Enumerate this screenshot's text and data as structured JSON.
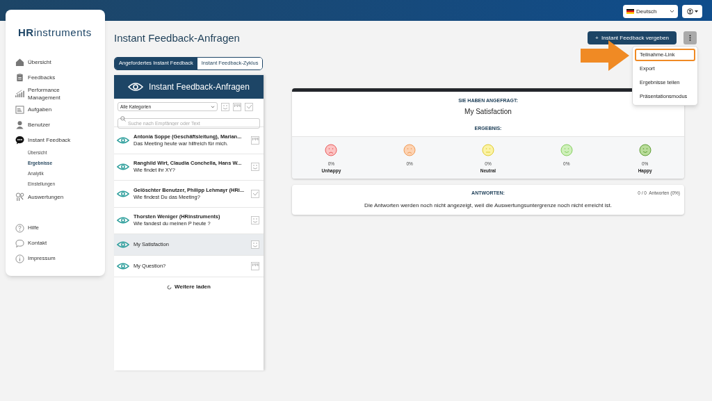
{
  "topbar": {
    "language": "Deutsch"
  },
  "sidebar": {
    "logo": {
      "brand": "HR",
      "rest": "instruments"
    },
    "items": [
      {
        "kind": "main",
        "label": "Übersicht",
        "selected": false
      },
      {
        "kind": "main",
        "label": "Feedbacks",
        "selected": false
      },
      {
        "kind": "main",
        "label": "Performance Management",
        "selected": false
      },
      {
        "kind": "main",
        "label": "Aufgaben",
        "selected": false
      },
      {
        "kind": "main",
        "label": "Benutzer",
        "selected": false
      },
      {
        "kind": "main",
        "label": "Instant Feedback",
        "selected": false
      },
      {
        "kind": "sub",
        "label": "Übersicht",
        "selected": false
      },
      {
        "kind": "sub",
        "label": "Ergebnisse",
        "selected": true
      },
      {
        "kind": "sub",
        "label": "Analytik",
        "selected": false
      },
      {
        "kind": "sub",
        "label": "Einstellungen",
        "selected": false
      },
      {
        "kind": "main",
        "label": "Auswertungen",
        "selected": false
      }
    ],
    "footer_items": [
      {
        "label": "Hilfe"
      },
      {
        "label": "Kontakt"
      },
      {
        "label": "Impressum"
      }
    ]
  },
  "page_title": "Instant Feedback-Anfragen",
  "tabs": [
    {
      "label": "Angefordertes Instant Feedback",
      "selected": true
    },
    {
      "label": "Instant Feedback-Zyklus",
      "selected": false
    }
  ],
  "primary_button": "+  Instant Feedback vergeben",
  "menu": {
    "items": [
      {
        "label": "Teilnahme-Link",
        "highlighted": true
      },
      {
        "label": "Export",
        "highlighted": false
      },
      {
        "label": "Ergebnisse teilen",
        "highlighted": false
      },
      {
        "label": "Präsentationsmodus",
        "highlighted": false
      }
    ]
  },
  "list_panel": {
    "title": "Instant Feedback-Anfragen",
    "category": "Alle Kategorien",
    "search": {
      "placeholder": "Suche nach Empfänger oder Text"
    },
    "requests": [
      {
        "title": "Antonia Soppe (Geschäftsleitung), Marian...",
        "text": "Das Meeting heute war hilfreich für mich.",
        "kind": "scale",
        "selected": false
      },
      {
        "title": "Ranghild Wirt, Claudia Conchella, Hans W...",
        "text": "Wie findet ihr XY?",
        "kind": "smiley",
        "selected": false
      },
      {
        "title": "Gelöschter Benutzer, Philipp Lehmayr (HRi...",
        "text": "Wie findest Du das Meeting?",
        "kind": "check",
        "selected": false
      },
      {
        "title": "Thorsten Weniger (HRinstruments)",
        "text": "Wie fandest du meinen P heute ?",
        "kind": "smiley",
        "selected": false
      },
      {
        "text": "My Satisfaction",
        "kind": "smiley",
        "selected": true
      },
      {
        "text": "My Question?",
        "kind": "scale",
        "selected": false
      }
    ],
    "load_more": "Weitere laden"
  },
  "result": {
    "asked_label": "SIE HABEN ANGEFRAGT:",
    "question": "My Satisfaction",
    "result_label": "ERGEBNIS:",
    "scale": [
      {
        "color": "#fcc4c4",
        "percent": "0%",
        "label": "Unhappy"
      },
      {
        "color": "#fdd3b3",
        "percent": "0%"
      },
      {
        "color": "#fbf3a6",
        "percent": "0%",
        "label": "Neutral"
      },
      {
        "color": "#cff0bb",
        "percent": "0%"
      },
      {
        "color": "#b9dc9a",
        "percent": "0%",
        "label": "Happy"
      }
    ]
  },
  "answers": {
    "label": "ANTWORTEN:",
    "count": "0 / 0  Antworten (0%)",
    "message": "Die Antworten werden noch nicht angezeigt, weil die Auswertungsuntergrenze noch nicht erreicht ist."
  }
}
